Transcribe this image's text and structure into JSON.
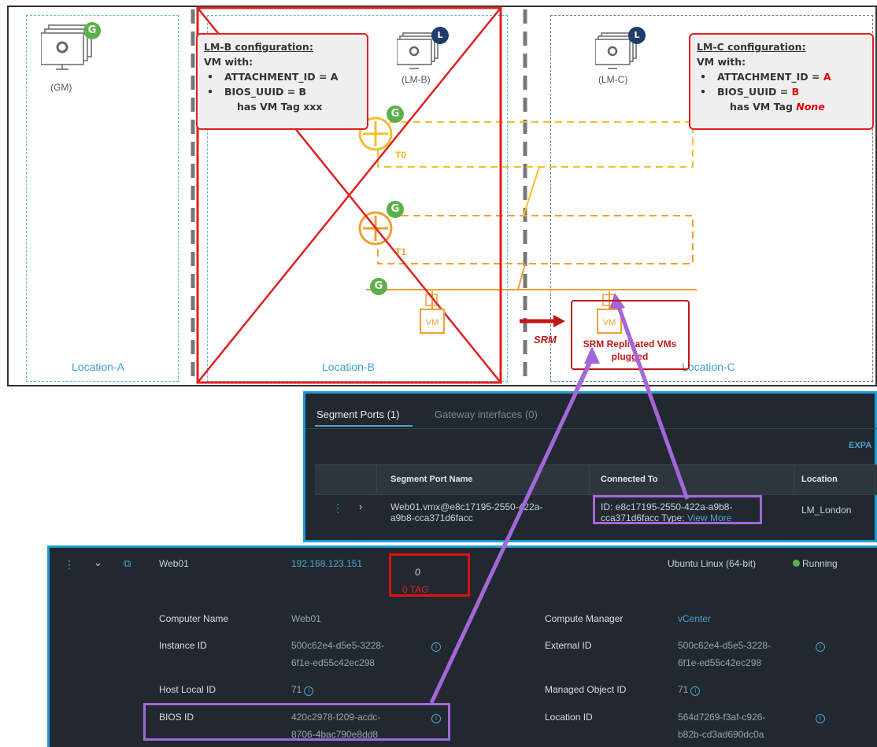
{
  "diagram": {
    "gm_label": "(GM)",
    "lmb_label": "(LM-B)",
    "lmc_label": "(LM-C)",
    "badge_g": "G",
    "badge_l": "L",
    "t0_label": "T0",
    "t1_label": "T1",
    "vm_label": "VM",
    "srm_label": "SRM",
    "srm_box_text": "SRM Replicated VMs plugged",
    "locations": [
      "Location-A",
      "Location-B",
      "Location-C"
    ],
    "lmb_config": {
      "title": "LM-B configuration:",
      "vm_with": "VM with:",
      "attachment": "ATTACHMENT_ID = A",
      "bios": "BIOS_UUID = B",
      "tag": "has VM Tag xxx"
    },
    "lmc_config": {
      "title": "LM-C configuration:",
      "vm_with": "VM with:",
      "attachment_key": "ATTACHMENT_ID = ",
      "attachment_val": "A",
      "bios_key": "BIOS_UUID = ",
      "bios_val": "B",
      "tag_key": "has VM Tag ",
      "tag_val": "None"
    },
    "colors": {
      "accent_red": "#e02020",
      "orange": "#f0a030",
      "purple": "#a466d8",
      "green": "#5cb04a",
      "navy": "#1f3c6c"
    }
  },
  "segment_panel": {
    "tabs": [
      "Segment Ports (1)",
      "Gateway interfaces (0)"
    ],
    "expand": "EXPA",
    "columns": [
      "Segment Port Name",
      "Connected To",
      "Location"
    ],
    "row": {
      "name_line1": "Web01.vmx@e8c17195-2550-422a-",
      "name_line2": "a9b8-cca371d6facc",
      "conn_line1": "ID: e8c17195-2550-422a-a9b8-",
      "conn_line2": "cca371d6facc Type: ",
      "conn_link": "View More",
      "location": "LM_London"
    }
  },
  "vm_panel": {
    "name": "Web01",
    "ip": "192.168.123.151",
    "tag_count": "0",
    "tag_label": "0 TAG",
    "os": "Ubuntu Linux (64-bit)",
    "status": "Running",
    "fields": {
      "computer_name_label": "Computer Name",
      "computer_name": "Web01",
      "instance_id_label": "Instance ID",
      "instance_id_1": "500c62e4-d5e5-3228-",
      "instance_id_2": "6f1e-ed55c42ec298",
      "host_local_id_label": "Host Local ID",
      "host_local_id": "71",
      "bios_id_label": "BIOS ID",
      "bios_id_1": "420c2978-f209-acdc-",
      "bios_id_2": "8706-4bac790e8dd8",
      "compute_manager_label": "Compute Manager",
      "compute_manager": "vCenter",
      "external_id_label": "External ID",
      "external_id_1": "500c62e4-d5e5-3228-",
      "external_id_2": "6f1e-ed55c42ec298",
      "moid_label": "Managed Object ID",
      "moid": "71",
      "location_id_label": "Location ID",
      "location_id_1": "564d7269-f3af-c926-",
      "location_id_2": "b82b-cd3ad690dc0a"
    }
  }
}
